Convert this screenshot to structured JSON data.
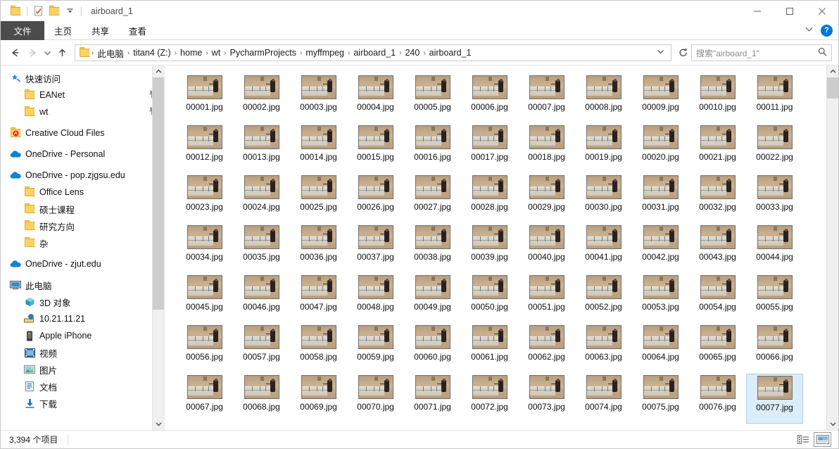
{
  "window": {
    "title": "airboard_1",
    "quick_access_icons": [
      "folder-icon",
      "properties-icon",
      "new-folder-icon",
      "customize-qat-chevron-icon"
    ],
    "controls": {
      "minimize": "minimize-icon",
      "maximize": "maximize-icon",
      "close": "close-icon"
    }
  },
  "ribbon": {
    "tabs": [
      {
        "label": "文件",
        "name": "tab-file",
        "active": true
      },
      {
        "label": "主页",
        "name": "tab-home",
        "active": false
      },
      {
        "label": "共享",
        "name": "tab-share",
        "active": false
      },
      {
        "label": "查看",
        "name": "tab-view",
        "active": false
      }
    ],
    "collapse_icon": "chevron-down-icon",
    "help_label": "?"
  },
  "address": {
    "back": "back-arrow-icon",
    "forward": "forward-arrow-icon",
    "recent": "chevron-down-icon",
    "up": "up-arrow-icon",
    "crumbs": [
      "此电脑",
      "titan4 (Z:)",
      "home",
      "wt",
      "PycharmProjects",
      "myffmpeg",
      "airboard_1",
      "240",
      "airboard_1"
    ],
    "separator": "›",
    "dropdown_icon": "chevron-down-icon",
    "refresh_icon": "refresh-icon"
  },
  "search": {
    "placeholder": "搜索\"airboard_1\"",
    "icon": "search-icon"
  },
  "sidebar": {
    "items": [
      {
        "label": "快速访问",
        "icon": "star-pin-icon",
        "indent": 0,
        "pinned": false
      },
      {
        "label": "EANet",
        "icon": "folder-icon",
        "indent": 1,
        "pinned": true
      },
      {
        "label": "wt",
        "icon": "folder-icon",
        "indent": 1,
        "pinned": true
      },
      {
        "label": "Creative Cloud Files",
        "icon": "creative-cloud-folder-icon",
        "indent": 0,
        "pinned": false
      },
      {
        "label": "OneDrive - Personal",
        "icon": "onedrive-cloud-icon",
        "indent": 0,
        "pinned": false
      },
      {
        "label": "OneDrive - pop.zjgsu.edu",
        "icon": "onedrive-cloud-icon",
        "indent": 0,
        "pinned": false
      },
      {
        "label": "Office Lens",
        "icon": "folder-icon",
        "indent": 1,
        "pinned": false
      },
      {
        "label": "硕士课程",
        "icon": "folder-icon",
        "indent": 1,
        "pinned": false
      },
      {
        "label": "研究方向",
        "icon": "folder-icon",
        "indent": 1,
        "pinned": false
      },
      {
        "label": "杂",
        "icon": "folder-icon",
        "indent": 1,
        "pinned": false
      },
      {
        "label": "OneDrive - zjut.edu",
        "icon": "onedrive-cloud-icon",
        "indent": 0,
        "pinned": false
      },
      {
        "label": "此电脑",
        "icon": "this-pc-icon",
        "indent": 0,
        "pinned": false
      },
      {
        "label": "3D 对象",
        "icon": "3d-objects-icon",
        "indent": 1,
        "pinned": false
      },
      {
        "label": "10.21.11.21",
        "icon": "network-drive-icon",
        "indent": 1,
        "pinned": false
      },
      {
        "label": "Apple iPhone",
        "icon": "phone-icon",
        "indent": 1,
        "pinned": false
      },
      {
        "label": "视频",
        "icon": "videos-icon",
        "indent": 1,
        "pinned": false
      },
      {
        "label": "图片",
        "icon": "pictures-icon",
        "indent": 1,
        "pinned": false
      },
      {
        "label": "文档",
        "icon": "documents-icon",
        "indent": 1,
        "pinned": false
      },
      {
        "label": "下载",
        "icon": "downloads-icon",
        "indent": 1,
        "pinned": false
      }
    ]
  },
  "files": {
    "columns_per_row": 11,
    "selected": "00077.jpg",
    "items": [
      "00001.jpg",
      "00002.jpg",
      "00003.jpg",
      "00004.jpg",
      "00005.jpg",
      "00006.jpg",
      "00007.jpg",
      "00008.jpg",
      "00009.jpg",
      "00010.jpg",
      "00011.jpg",
      "00012.jpg",
      "00013.jpg",
      "00014.jpg",
      "00015.jpg",
      "00016.jpg",
      "00017.jpg",
      "00018.jpg",
      "00019.jpg",
      "00020.jpg",
      "00021.jpg",
      "00022.jpg",
      "00023.jpg",
      "00024.jpg",
      "00025.jpg",
      "00026.jpg",
      "00027.jpg",
      "00028.jpg",
      "00029.jpg",
      "00030.jpg",
      "00031.jpg",
      "00032.jpg",
      "00033.jpg",
      "00034.jpg",
      "00035.jpg",
      "00036.jpg",
      "00037.jpg",
      "00038.jpg",
      "00039.jpg",
      "00040.jpg",
      "00041.jpg",
      "00042.jpg",
      "00043.jpg",
      "00044.jpg",
      "00045.jpg",
      "00046.jpg",
      "00047.jpg",
      "00048.jpg",
      "00049.jpg",
      "00050.jpg",
      "00051.jpg",
      "00052.jpg",
      "00053.jpg",
      "00054.jpg",
      "00055.jpg",
      "00056.jpg",
      "00057.jpg",
      "00058.jpg",
      "00059.jpg",
      "00060.jpg",
      "00061.jpg",
      "00062.jpg",
      "00063.jpg",
      "00064.jpg",
      "00065.jpg",
      "00066.jpg",
      "00067.jpg",
      "00068.jpg",
      "00069.jpg",
      "00070.jpg",
      "00071.jpg",
      "00072.jpg",
      "00073.jpg",
      "00074.jpg",
      "00075.jpg",
      "00076.jpg",
      "00077.jpg"
    ]
  },
  "status": {
    "item_count": "3,394 个项目",
    "views": [
      {
        "name": "details-view-button",
        "icon": "details-view-icon",
        "active": false
      },
      {
        "name": "large-icons-view-button",
        "icon": "large-icons-view-icon",
        "active": true
      }
    ]
  },
  "colors": {
    "accent": "#0078d7",
    "selection_bg": "#dcedfa",
    "selection_border": "#a7d2f0",
    "tab_active_bg": "#4c4c4c",
    "folder_yellow": "#fcd263"
  }
}
